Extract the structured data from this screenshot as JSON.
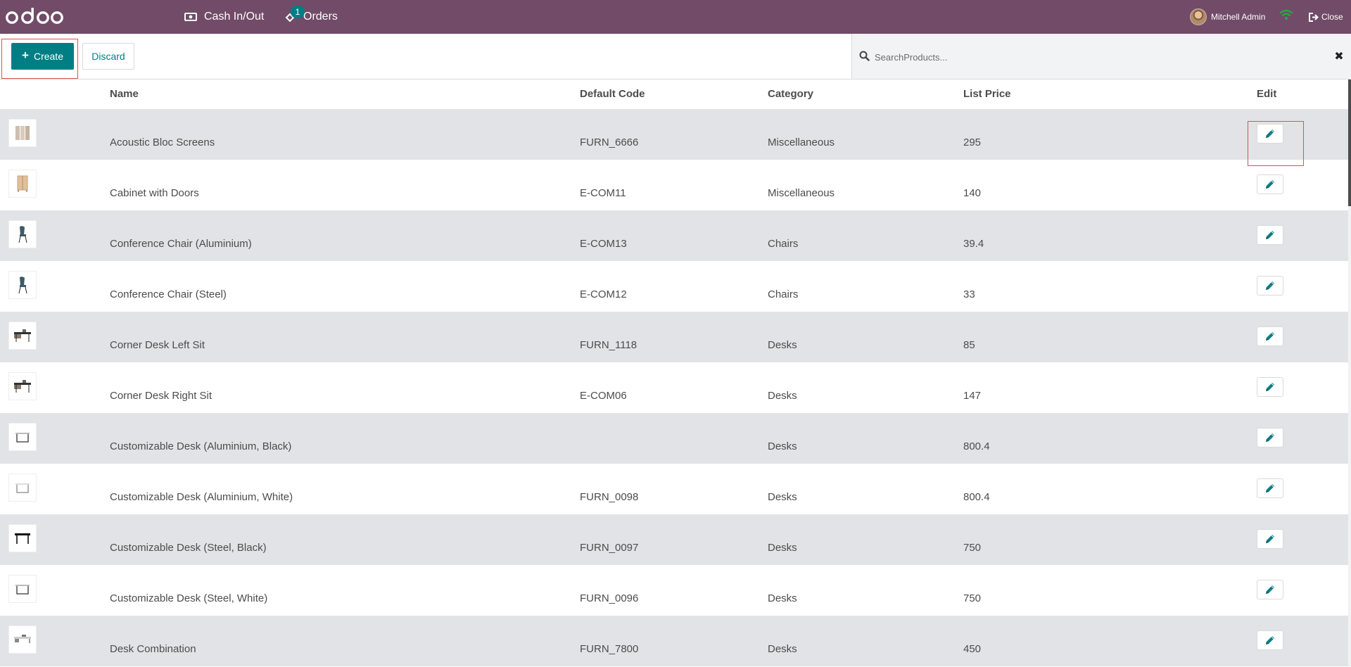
{
  "navbar": {
    "logo_text": "odoo",
    "cash_label": "Cash In/Out",
    "orders_label": "Orders",
    "orders_badge": "1",
    "user_name": "Mitchell Admin",
    "close_label": "Close"
  },
  "controls": {
    "create_label": "Create",
    "discard_label": "Discard"
  },
  "search": {
    "placeholder": "SearchProducts...",
    "value": ""
  },
  "table": {
    "headers": {
      "name": "Name",
      "code": "Default Code",
      "category": "Category",
      "price": "List Price",
      "edit": "Edit"
    },
    "rows": [
      {
        "name": "Acoustic Bloc Screens",
        "code": "FURN_6666",
        "category": "Miscellaneous",
        "price": "295",
        "image": "screen-panel"
      },
      {
        "name": "Cabinet with Doors",
        "code": "E-COM11",
        "category": "Miscellaneous",
        "price": "140",
        "image": "cabinet"
      },
      {
        "name": "Conference Chair (Aluminium)",
        "code": "E-COM13",
        "category": "Chairs",
        "price": "39.4",
        "image": "chair"
      },
      {
        "name": "Conference Chair (Steel)",
        "code": "E-COM12",
        "category": "Chairs",
        "price": "33",
        "image": "chair"
      },
      {
        "name": "Corner Desk Left Sit",
        "code": "FURN_1118",
        "category": "Desks",
        "price": "85",
        "image": "corner-desk"
      },
      {
        "name": "Corner Desk Right Sit",
        "code": "E-COM06",
        "category": "Desks",
        "price": "147",
        "image": "corner-desk"
      },
      {
        "name": "Customizable Desk (Aluminium, Black)",
        "code": "",
        "category": "Desks",
        "price": "800.4",
        "image": "desk"
      },
      {
        "name": "Customizable Desk (Aluminium, White)",
        "code": "FURN_0098",
        "category": "Desks",
        "price": "800.4",
        "image": "desk-light"
      },
      {
        "name": "Customizable Desk (Steel, Black)",
        "code": "FURN_0097",
        "category": "Desks",
        "price": "750",
        "image": "desk-dark"
      },
      {
        "name": "Customizable Desk (Steel, White)",
        "code": "FURN_0096",
        "category": "Desks",
        "price": "750",
        "image": "desk"
      },
      {
        "name": "Desk Combination",
        "code": "FURN_7800",
        "category": "Desks",
        "price": "450",
        "image": "desk-combo"
      }
    ]
  },
  "colors": {
    "navbar": "#714b67",
    "primary": "#017e84",
    "row_alt": "#e2e3e6",
    "highlight": "#d9534f"
  }
}
